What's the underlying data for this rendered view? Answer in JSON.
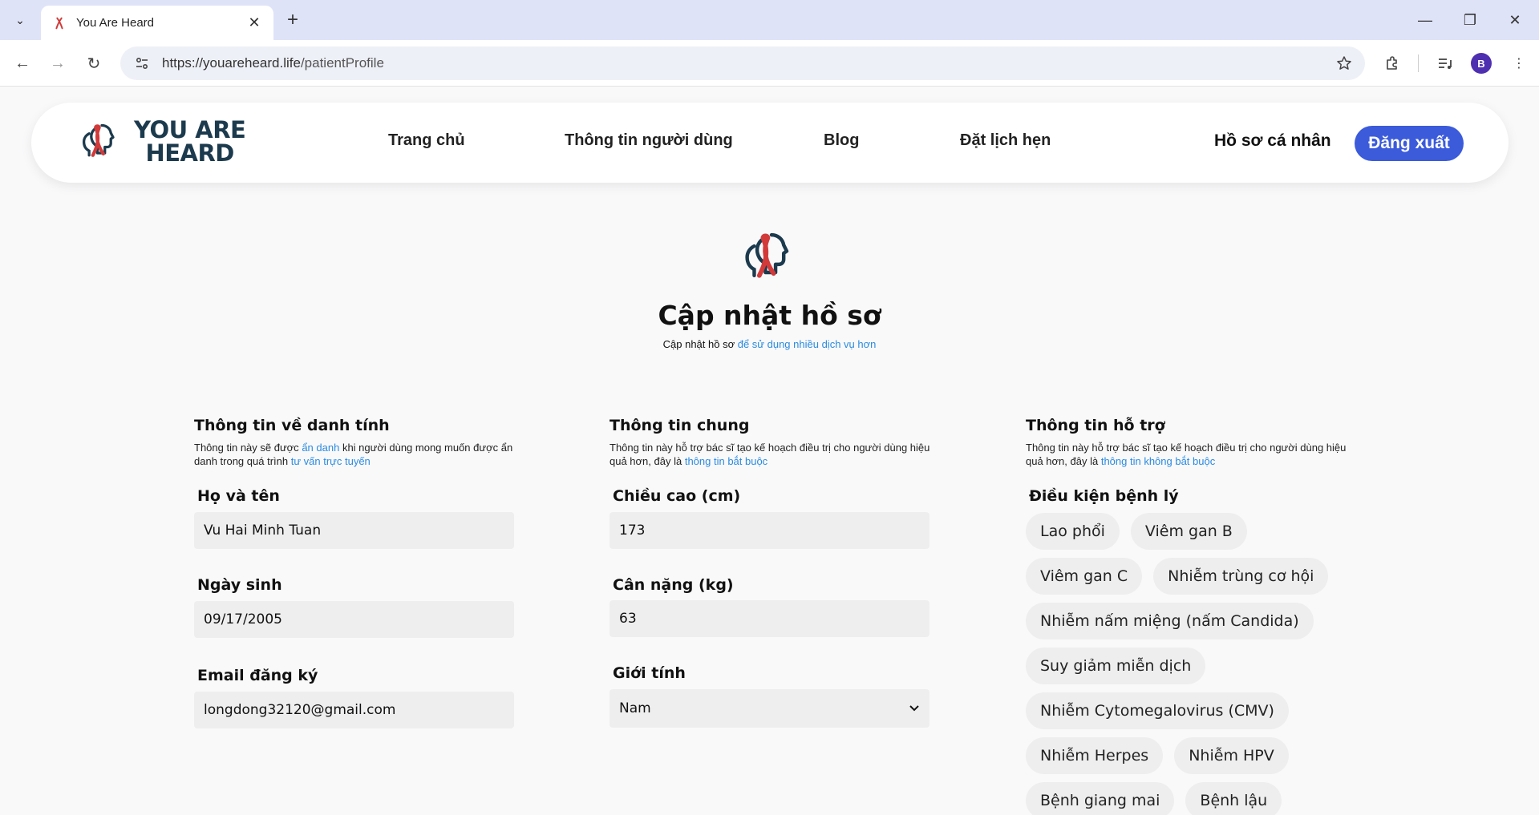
{
  "browser": {
    "tab_title": "You Are Heard",
    "url_host": "https://youareheard.life",
    "url_path": "/patientProfile",
    "profile_initial": "B"
  },
  "header": {
    "logo_line1": "YOU ARE",
    "logo_line2": "HEARD",
    "nav": [
      "Trang chủ",
      "Thông tin người dùng",
      "Blog",
      "Đặt lịch hẹn"
    ],
    "profile_link": "Hồ sơ cá nhân",
    "logout": "Đăng xuất"
  },
  "page": {
    "title": "Cập nhật hồ sơ",
    "subtitle_plain": "Cập nhật hồ sơ",
    "subtitle_highlight": "để sử dụng nhiều dịch vụ hơn"
  },
  "identity": {
    "title": "Thông tin về danh tính",
    "desc_1": "Thông tin này sẽ được",
    "desc_hl1": "ẩn danh",
    "desc_2": "khi người dùng mong muốn được ẩn danh trong quá trình",
    "desc_hl2": "tư vấn trực tuyến",
    "name_label": "Họ và tên",
    "name_value": "Vu Hai Minh Tuan",
    "dob_label": "Ngày sinh",
    "dob_value": "09/17/2005",
    "email_label": "Email đăng ký",
    "email_value": "longdong32120@gmail.com"
  },
  "general": {
    "title": "Thông tin chung",
    "desc": "Thông tin này hỗ trợ bác sĩ tạo kế hoạch điều trị cho người dùng hiệu quả hơn, đây là",
    "desc_hl": "thông tin bắt buộc",
    "height_label": "Chiều cao (cm)",
    "height_value": "173",
    "weight_label": "Cân nặng (kg)",
    "weight_value": "63",
    "gender_label": "Giới tính",
    "gender_value": "Nam"
  },
  "support": {
    "title": "Thông tin hỗ trợ",
    "desc": "Thông tin này hỗ trợ bác sĩ tạo kế hoạch điều trị cho người dùng hiệu quả hơn, đây là",
    "desc_hl": "thông tin không bắt buộc",
    "conditions_label": "Điều kiện bệnh lý",
    "conditions": [
      "Lao phổi",
      "Viêm gan B",
      "Viêm gan C",
      "Nhiễm trùng cơ hội",
      "Nhiễm nấm miệng (nấm Candida)",
      "Suy giảm miễn dịch",
      "Nhiễm Cytomegalovirus (CMV)",
      "Nhiễm Herpes",
      "Nhiễm HPV",
      "Bệnh giang mai",
      "Bệnh lậu"
    ]
  },
  "colors": {
    "accent": "#3b5bdb",
    "link": "#2b8be0",
    "ribbon": "#d23a3a",
    "brand": "#1c3a4d"
  }
}
